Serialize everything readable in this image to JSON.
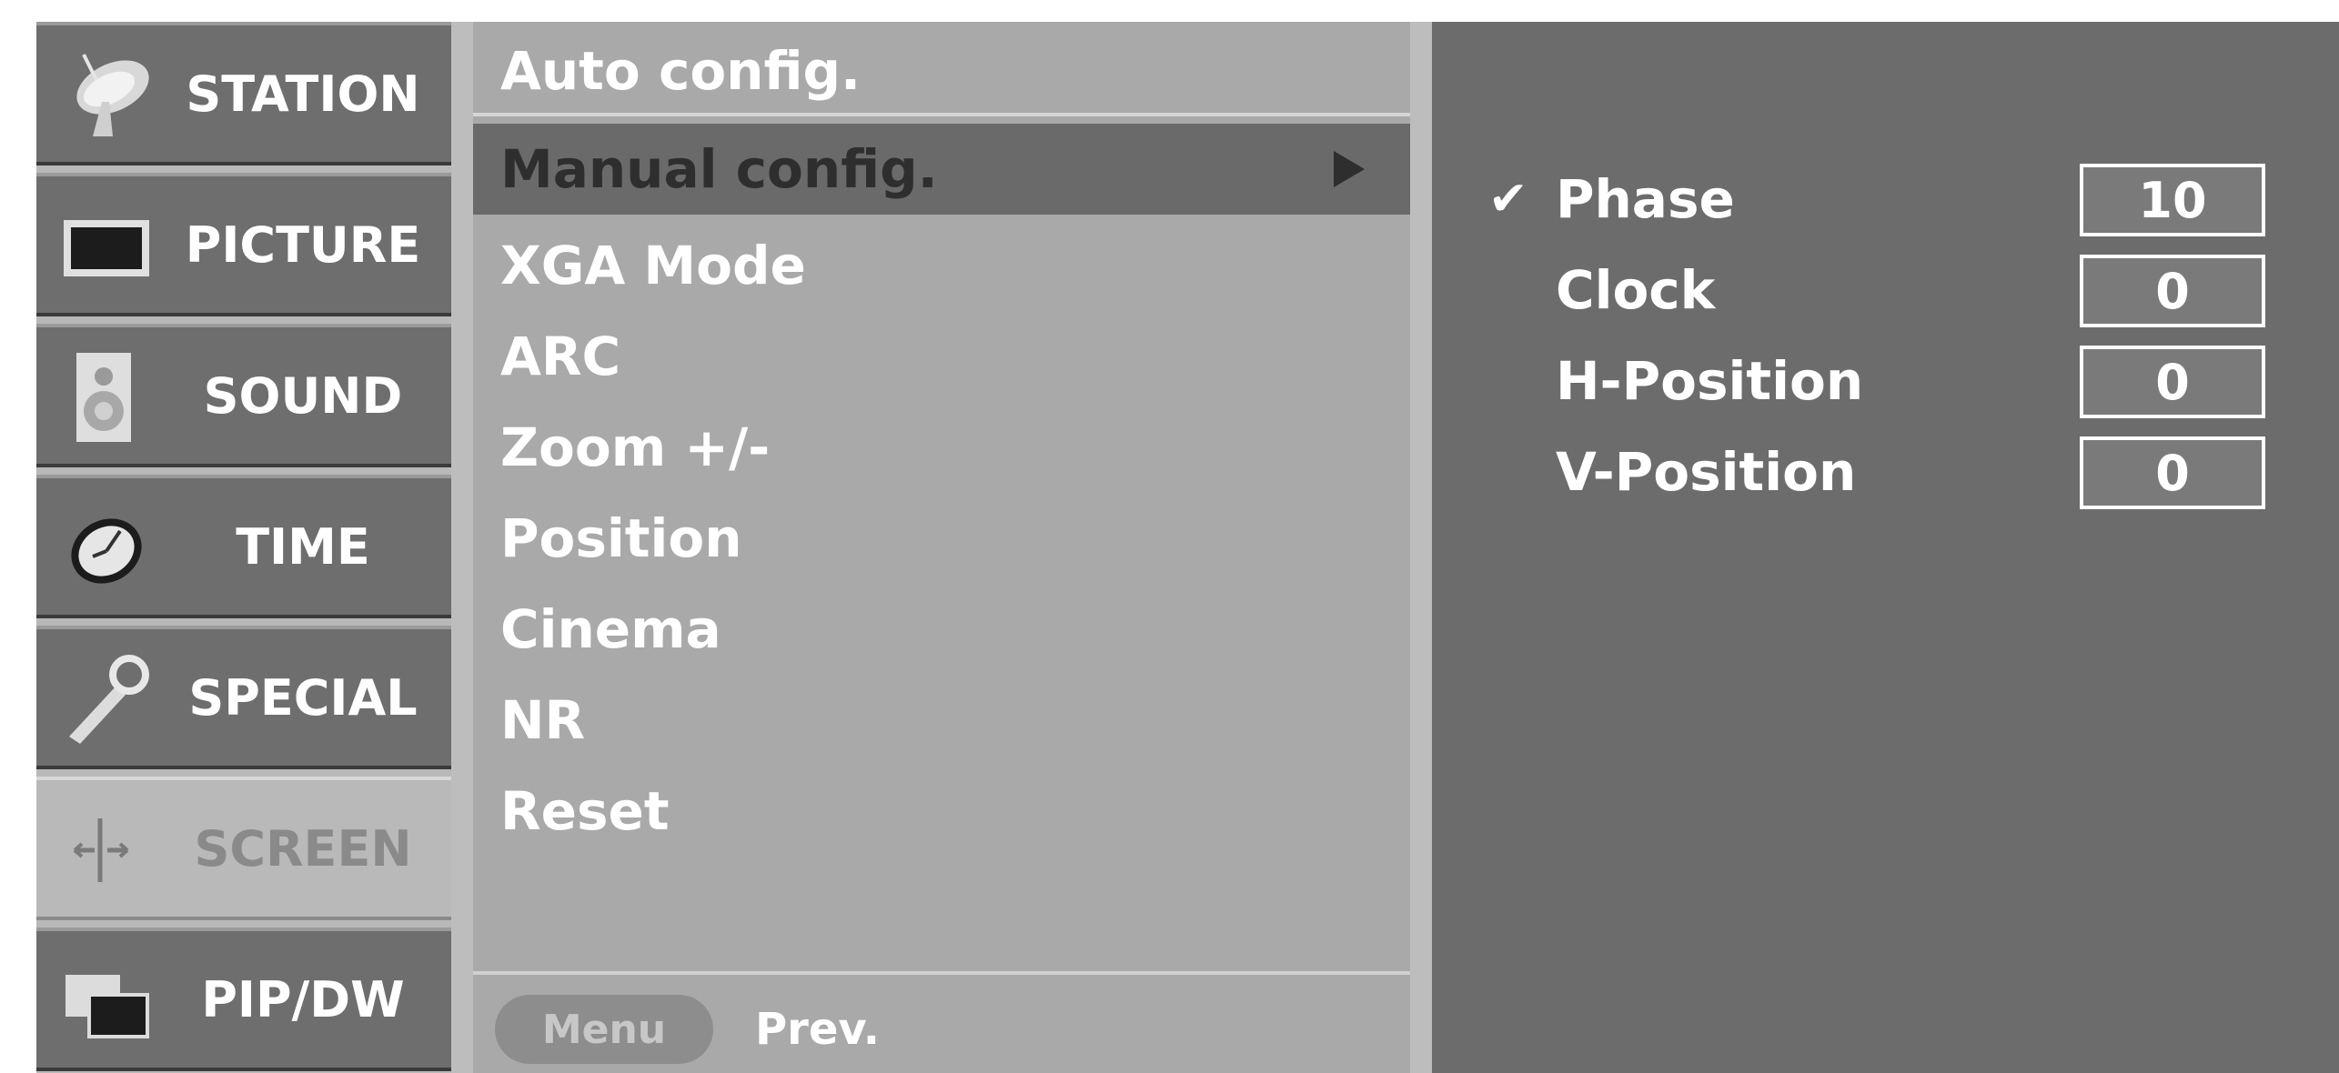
{
  "categories": [
    {
      "label": "STATION",
      "icon": "satellite-dish-icon"
    },
    {
      "label": "PICTURE",
      "icon": "tv-screen-icon"
    },
    {
      "label": "SOUND",
      "icon": "speaker-icon"
    },
    {
      "label": "TIME",
      "icon": "clock-icon"
    },
    {
      "label": "SPECIAL",
      "icon": "wrench-icon"
    },
    {
      "label": "SCREEN",
      "icon": "screen-adjust-icon",
      "active": true
    },
    {
      "label": "PIP/DW",
      "icon": "pip-windows-icon"
    }
  ],
  "submenu": {
    "items": [
      {
        "label": "Auto config."
      },
      {
        "label": "Manual config.",
        "selected": true
      },
      {
        "label": "XGA Mode"
      },
      {
        "label": "ARC"
      },
      {
        "label": "Zoom +/-"
      },
      {
        "label": "Position"
      },
      {
        "label": "Cinema"
      },
      {
        "label": "NR"
      },
      {
        "label": "Reset"
      }
    ],
    "nav": {
      "menu_button": "Menu",
      "prev_label": "Prev."
    }
  },
  "settings": {
    "rows": [
      {
        "label": "Phase",
        "value": "10",
        "checked": true,
        "check": "✔"
      },
      {
        "label": "Clock",
        "value": "0"
      },
      {
        "label": "H-Position",
        "value": "0"
      },
      {
        "label": "V-Position",
        "value": "0"
      }
    ]
  },
  "colors": {
    "panel_dark": "#6c6c6c",
    "panel_light": "#a9a9a9",
    "text": "#ffffff"
  }
}
